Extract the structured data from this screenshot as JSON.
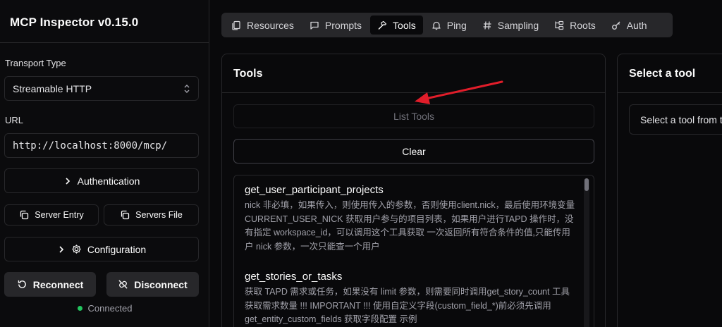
{
  "app": {
    "title": "MCP Inspector v0.15.0"
  },
  "sidebar": {
    "transport_label": "Transport Type",
    "transport_value": "Streamable HTTP",
    "url_label": "URL",
    "url_value": "http://localhost:8000/mcp/",
    "authentication_label": "Authentication",
    "server_entry_label": "Server Entry",
    "servers_file_label": "Servers File",
    "configuration_label": "Configuration",
    "reconnect_label": "Reconnect",
    "disconnect_label": "Disconnect",
    "status_text": "Connected",
    "status_color": "#22c55e"
  },
  "tabs": [
    {
      "label": "Resources",
      "icon": "files-icon"
    },
    {
      "label": "Prompts",
      "icon": "message-icon"
    },
    {
      "label": "Tools",
      "icon": "hammer-icon",
      "active": true
    },
    {
      "label": "Ping",
      "icon": "bell-icon"
    },
    {
      "label": "Sampling",
      "icon": "hash-icon"
    },
    {
      "label": "Roots",
      "icon": "folder-tree-icon"
    },
    {
      "label": "Auth",
      "icon": "key-icon"
    }
  ],
  "tools_panel": {
    "title": "Tools",
    "list_button": "List Tools",
    "clear_button": "Clear",
    "items": [
      {
        "name": "get_user_participant_projects",
        "description": "nick 非必填，如果传入，则使用传入的参数，否则使用client.nick，最后使用环境变量CURRENT_USER_NICK 获取用户参与的项目列表，如果用户进行TAPD 操作时，没有指定 workspace_id，可以调用这个工具获取 一次返回所有符合条件的值,只能传用户 nick 参数，一次只能查一个用户"
      },
      {
        "name": "get_stories_or_tasks",
        "description": "获取 TAPD 需求或任务，如果没有 limit 参数，则需要同时调用get_story_count 工具获取需求数量 !!! IMPORTANT !!! 使用自定义字段(custom_field_*)前必须先调用 get_entity_custom_fields 获取字段配置 示例"
      }
    ]
  },
  "detail_panel": {
    "title": "Select a tool",
    "placeholder": "Select a tool from the list to view its details and run it"
  }
}
